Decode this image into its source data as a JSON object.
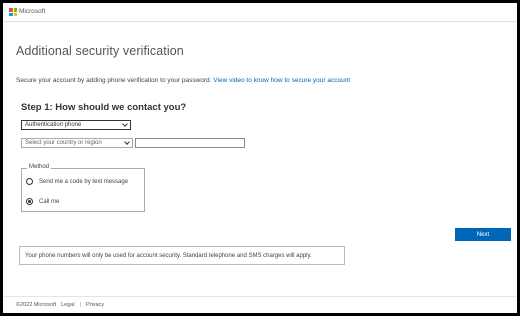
{
  "brand": {
    "name": "Microsoft",
    "logo_colors": [
      "#f25022",
      "#7fba00",
      "#00a4ef",
      "#ffb900"
    ]
  },
  "page": {
    "title": "Additional security verification",
    "intro_text": "Secure your account by adding phone verification to your password.",
    "intro_link": "View video to know how to secure your account"
  },
  "step1": {
    "heading": "Step 1: How should we contact you?",
    "contact_method_selected": "Authentication phone",
    "country_placeholder": "Select your country or region",
    "phone_value": ""
  },
  "method": {
    "legend": "Method",
    "options": [
      {
        "label": "Send me a code by text message",
        "selected": false
      },
      {
        "label": "Call me",
        "selected": true
      }
    ]
  },
  "actions": {
    "next_label": "Next"
  },
  "notice": {
    "text": "Your phone numbers will only be used for account security. Standard telephone and SMS charges will apply."
  },
  "footer": {
    "copyright": "©2022 Microsoft",
    "legal": "Legal",
    "separator": "|",
    "privacy": "Privacy"
  },
  "colors": {
    "accent": "#0067b8"
  }
}
